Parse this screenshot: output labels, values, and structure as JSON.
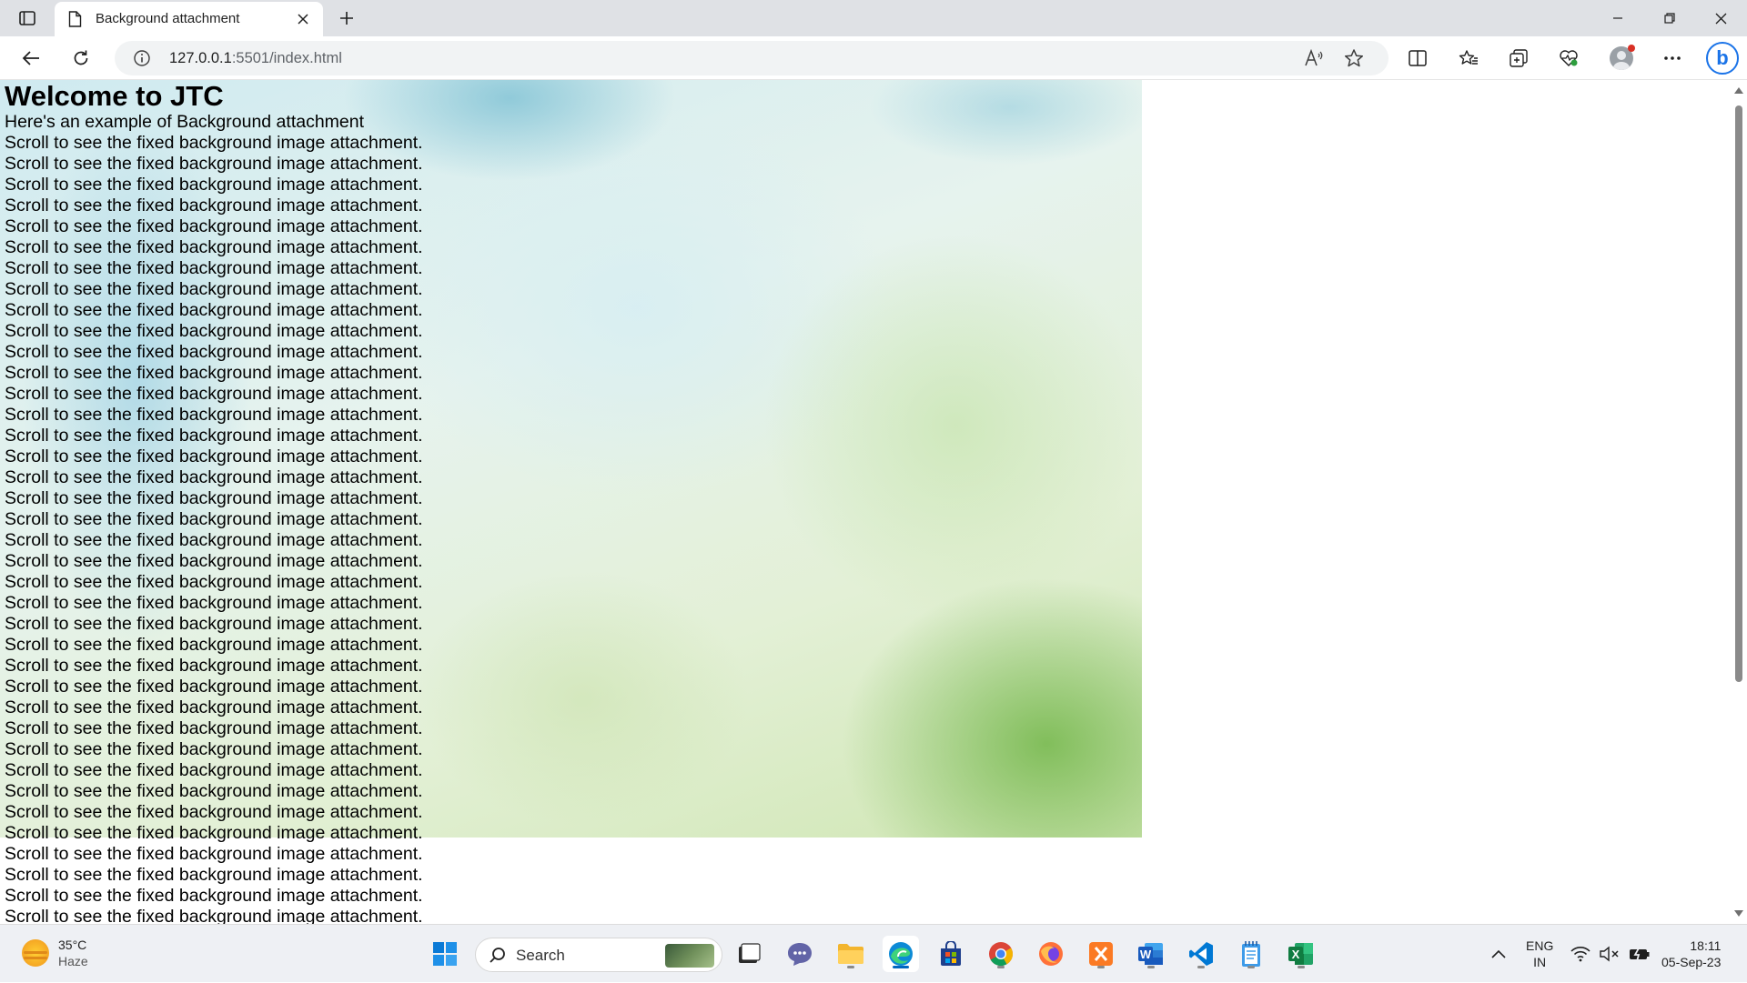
{
  "browser": {
    "tab_title": "Background attachment",
    "url_host": "127.0.0.1",
    "url_rest": ":5501/index.html"
  },
  "page": {
    "heading": "Welcome to JTC",
    "intro": "Here's an example of Background attachment",
    "lines": [
      "Scroll to see the fixed background image attachment.",
      "Scroll to see the fixed background image attachment.",
      "Scroll to see the fixed background image attachment.",
      "Scroll to see the fixed background image attachment.",
      "Scroll to see the fixed background image attachment.",
      "Scroll to see the fixed background image attachment.",
      "Scroll to see the fixed background image attachment.",
      "Scroll to see the fixed background image attachment.",
      "Scroll to see the fixed background image attachment.",
      "Scroll to see the fixed background image attachment.",
      "Scroll to see the fixed background image attachment.",
      "Scroll to see the fixed background image attachment.",
      "Scroll to see the fixed background image attachment.",
      "Scroll to see the fixed background image attachment.",
      "Scroll to see the fixed background image attachment.",
      "Scroll to see the fixed background image attachment.",
      "Scroll to see the fixed background image attachment.",
      "Scroll to see the fixed background image attachment.",
      "Scroll to see the fixed background image attachment.",
      "Scroll to see the fixed background image attachment.",
      "Scroll to see the fixed background image attachment.",
      "Scroll to see the fixed background image attachment.",
      "Scroll to see the fixed background image attachment.",
      "Scroll to see the fixed background image attachment.",
      "Scroll to see the fixed background image attachment.",
      "Scroll to see the fixed background image attachment.",
      "Scroll to see the fixed background image attachment.",
      "Scroll to see the fixed background image attachment.",
      "Scroll to see the fixed background image attachment.",
      "Scroll to see the fixed background image attachment.",
      "Scroll to see the fixed background image attachment.",
      "Scroll to see the fixed background image attachment.",
      "Scroll to see the fixed background image attachment.",
      "Scroll to see the fixed background image attachment.",
      "Scroll to see the fixed background image attachment.",
      "Scroll to see the fixed background image attachment.",
      "Scroll to see the fixed background image attachment.",
      "Scroll to see the fixed background image attachment."
    ]
  },
  "taskbar": {
    "weather_temp": "35°C",
    "weather_condition": "Haze",
    "search_placeholder": "Search",
    "language_primary": "ENG",
    "language_region": "IN",
    "time": "18:11",
    "date": "05-Sep-23",
    "apps": [
      "start",
      "search",
      "task-view",
      "teams-chat",
      "file-explorer",
      "edge",
      "microsoft-store",
      "chrome",
      "firefox",
      "xampp",
      "word",
      "vscode",
      "notepad",
      "excel"
    ]
  },
  "colors": {
    "accent": "#0067c0",
    "tabstrip": "#dfe1e5",
    "taskbar": "#eef0f4"
  }
}
